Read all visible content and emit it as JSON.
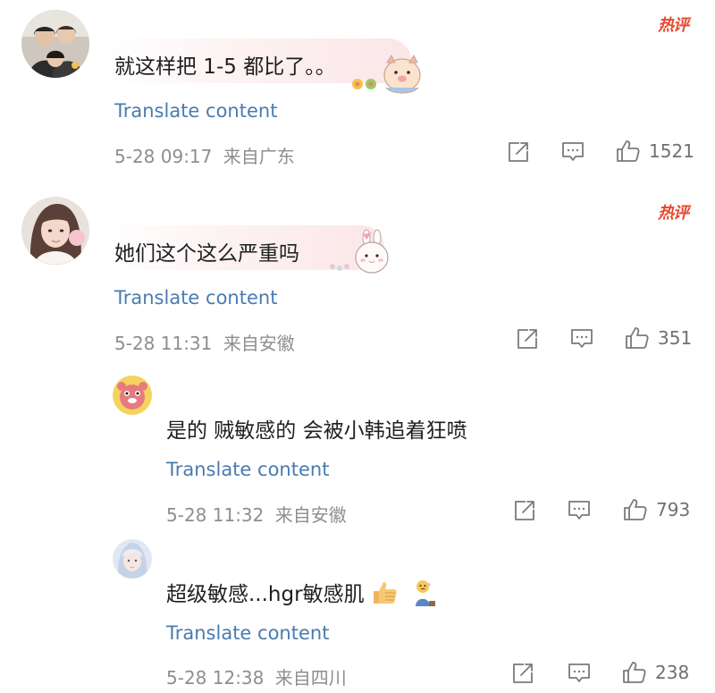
{
  "hot_badge": "热评",
  "translate_label": "Translate content",
  "comments": [
    {
      "text": "就这样把 1-5 都比了。。",
      "timestamp": "5-28 09:17",
      "location": "来自广东",
      "likes": "1521",
      "hot": true,
      "sticker": "pig-sticker"
    },
    {
      "text": "她们这个这么严重吗",
      "timestamp": "5-28 11:31",
      "location": "来自安徽",
      "likes": "351",
      "hot": true,
      "sticker": "bunny-sticker"
    },
    {
      "text": "是的 贼敏感的 会被小韩追着狂喷",
      "timestamp": "5-28 11:32",
      "location": "来自安徽",
      "likes": "793",
      "hot": false
    },
    {
      "text": "超级敏感...hgr敏感肌",
      "timestamp": "5-28 12:38",
      "location": "来自四川",
      "likes": "238",
      "hot": false,
      "emojis": [
        "thumbs-up-emoji",
        "sweating-figure-emoji"
      ]
    }
  ],
  "icons": {
    "share": "share-icon",
    "comment": "comment-icon",
    "like": "thumbs-up-icon"
  },
  "colors": {
    "hot_badge": "#e8482f",
    "translate_link": "#4a7bb0",
    "meta_text": "#8e8e8e"
  }
}
